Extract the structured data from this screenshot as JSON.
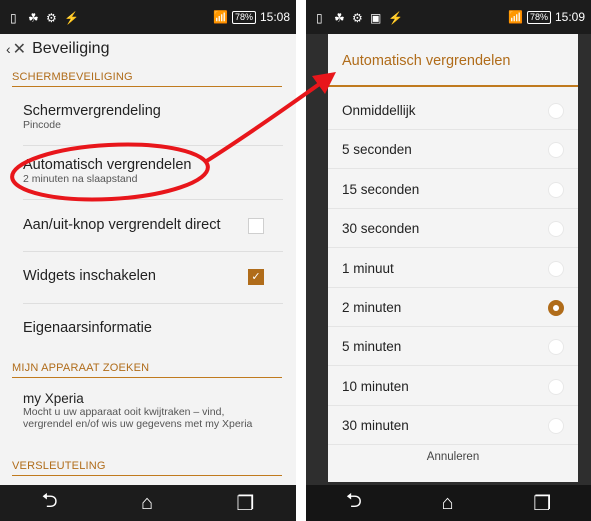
{
  "left_phone": {
    "status": {
      "battery": "78%",
      "time": "15:08"
    },
    "action_title": "Beveiliging",
    "sections": [
      {
        "title": "SCHERMBEVEILIGING"
      },
      {
        "title": "MIJN APPARAAT ZOEKEN"
      },
      {
        "title": "VERSLEUTELING"
      }
    ],
    "items": {
      "screen_lock": {
        "title": "Schermvergrendeling",
        "sub": "Pincode"
      },
      "auto_lock": {
        "title": "Automatisch vergrendelen",
        "sub": "2 minuten na slaapstand"
      },
      "power_lock": {
        "title": "Aan/uit-knop vergrendelt direct",
        "checked": false
      },
      "widgets": {
        "title": "Widgets inschakelen",
        "checked": true
      },
      "owner_info": {
        "title": "Eigenaarsinformatie"
      },
      "my_xperia": {
        "title": "my Xperia",
        "sub": "Mocht u uw apparaat ooit kwijtraken – vind, vergrendel en/of wis uw gegevens met my Xperia"
      }
    }
  },
  "right_phone": {
    "status": {
      "battery": "78%",
      "time": "15:09"
    },
    "dialog": {
      "title": "Automatisch vergrendelen",
      "options": [
        "Onmiddellijk",
        "5 seconden",
        "15 seconden",
        "30 seconden",
        "1 minuut",
        "2 minuten",
        "5 minuten",
        "10 minuten",
        "30 minuten"
      ],
      "selected_index": 5,
      "cancel_label": "Annuleren"
    }
  },
  "colors": {
    "accent": "#b06c1a",
    "annotation": "#e8161b"
  }
}
